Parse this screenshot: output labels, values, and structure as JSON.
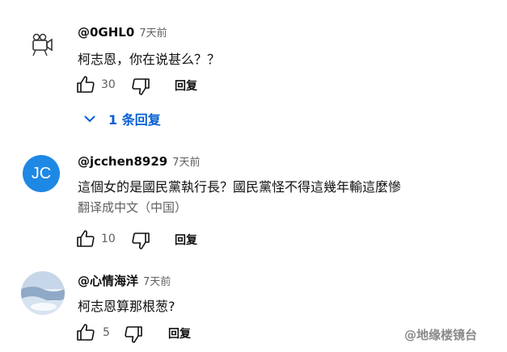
{
  "comments": [
    {
      "handle": "@0GHL0",
      "time": "7天前",
      "text": "柯志恩，你在说甚么？？",
      "likes": "30",
      "reply_label": "回复",
      "replies_link": "1 条回复",
      "avatar_icon": "camera-doodle-icon"
    },
    {
      "handle": "@jcchen8929",
      "time": "7天前",
      "text": "這個女的是國民黨執行長？國民黨怪不得這幾年輸這麼慘",
      "translate": "翻译成中文（中国）",
      "likes": "10",
      "reply_label": "回复",
      "avatar_initials": "JC",
      "avatar_color": "#1e88e5"
    },
    {
      "handle": "@心情海洋",
      "time": "7天前",
      "text": "柯志恩算那根葱?",
      "likes": "5",
      "reply_label": "回复",
      "avatar_icon": "ocean-photo-icon"
    }
  ],
  "watermark": "@地缘楼镜台",
  "icons": {
    "like": "thumbs-up-icon",
    "dislike": "thumbs-down-icon",
    "expand": "chevron-down-icon"
  }
}
